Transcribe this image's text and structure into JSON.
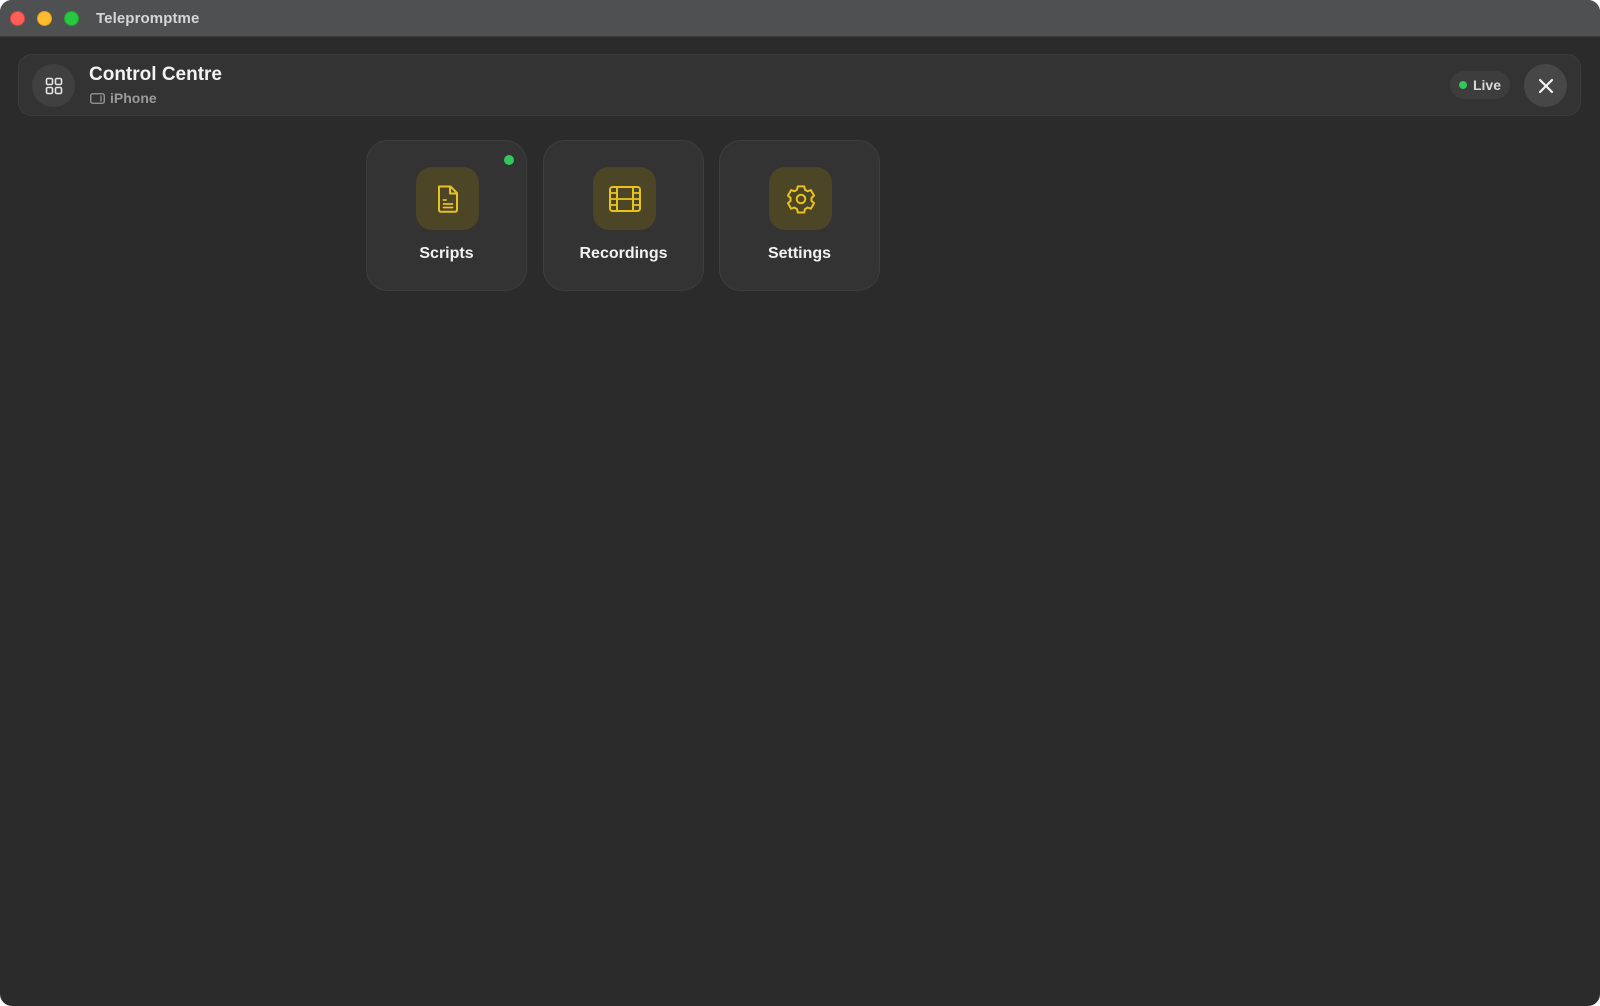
{
  "window": {
    "title": "Telepromptme"
  },
  "header": {
    "title": "Control Centre",
    "device": "iPhone",
    "device_icon": "iphone-landscape-icon",
    "status_label": "Live",
    "status_color": "#32c75a"
  },
  "tiles": [
    {
      "label": "Scripts",
      "icon": "document-icon",
      "has_indicator": true
    },
    {
      "label": "Recordings",
      "icon": "film-icon",
      "has_indicator": false
    },
    {
      "label": "Settings",
      "icon": "gear-icon",
      "has_indicator": false
    }
  ],
  "colors": {
    "accent": "#e8c21e",
    "indicator": "#32c75a",
    "background": "#2b2b2b"
  }
}
